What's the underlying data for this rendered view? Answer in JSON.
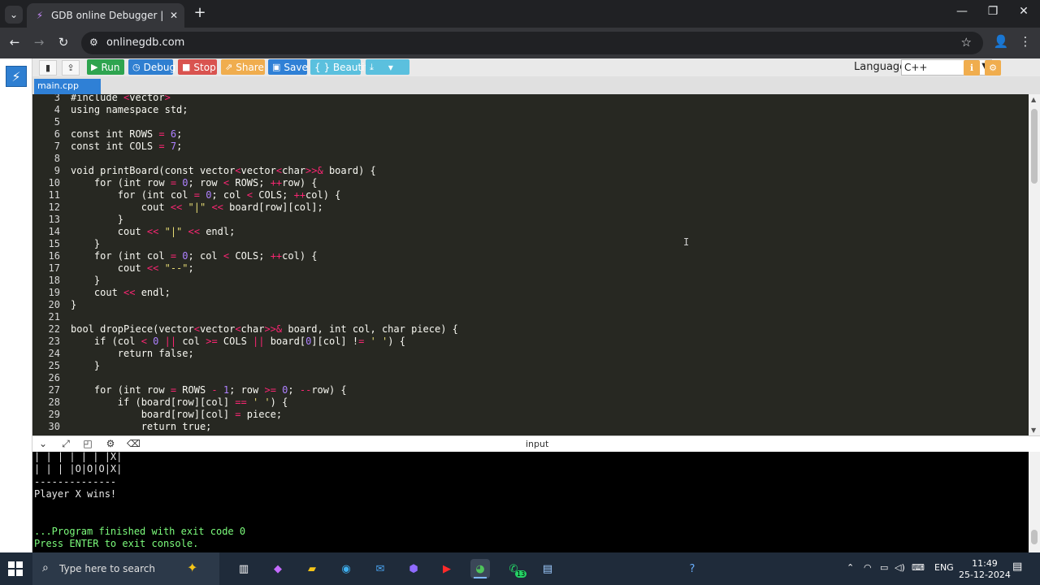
{
  "browser": {
    "tab_title": "GDB online Debugger | Compile",
    "url": "onlinegdb.com"
  },
  "toolbar": {
    "run_label": "Run",
    "debug_label": "Debug",
    "stop_label": "Stop",
    "share_label": "Share",
    "save_label": "Save",
    "beautify_label": "{ } Beautify",
    "language_label": "Language",
    "language_value": "C++"
  },
  "file_tab": "main.cpp",
  "editor": {
    "lines": [
      {
        "n": "3",
        "html": "#include <vector>"
      },
      {
        "n": "4",
        "html": "using namespace std;"
      },
      {
        "n": "5",
        "html": ""
      },
      {
        "n": "6",
        "html": "const int ROWS = 6;"
      },
      {
        "n": "7",
        "html": "const int COLS = 7;"
      },
      {
        "n": "8",
        "html": ""
      },
      {
        "n": "9",
        "html": "void printBoard(const vector<vector<char>>& board) {"
      },
      {
        "n": "10",
        "html": "    for (int row = 0; row < ROWS; ++row) {"
      },
      {
        "n": "11",
        "html": "        for (int col = 0; col < COLS; ++col) {"
      },
      {
        "n": "12",
        "html": "            cout << \"|\" << board[row][col];"
      },
      {
        "n": "13",
        "html": "        }"
      },
      {
        "n": "14",
        "html": "        cout << \"|\" << endl;"
      },
      {
        "n": "15",
        "html": "    }"
      },
      {
        "n": "16",
        "html": "    for (int col = 0; col < COLS; ++col) {"
      },
      {
        "n": "17",
        "html": "        cout << \"--\";"
      },
      {
        "n": "18",
        "html": "    }"
      },
      {
        "n": "19",
        "html": "    cout << endl;"
      },
      {
        "n": "20",
        "html": "}"
      },
      {
        "n": "21",
        "html": ""
      },
      {
        "n": "22",
        "html": "bool dropPiece(vector<vector<char>>& board, int col, char piece) {"
      },
      {
        "n": "23",
        "html": "    if (col < 0 || col >= COLS || board[0][col] != ' ') {"
      },
      {
        "n": "24",
        "html": "        return false;"
      },
      {
        "n": "25",
        "html": "    }"
      },
      {
        "n": "26",
        "html": ""
      },
      {
        "n": "27",
        "html": "    for (int row = ROWS - 1; row >= 0; --row) {"
      },
      {
        "n": "28",
        "html": "        if (board[row][col] == ' ') {"
      },
      {
        "n": "29",
        "html": "            board[row][col] = piece;"
      },
      {
        "n": "30",
        "html": "            return true;"
      }
    ]
  },
  "output": {
    "title": "input",
    "lines": [
      {
        "text": "| | | | | | |X|",
        "style": "normal"
      },
      {
        "text": "| | | |O|O|O|X|",
        "style": "normal"
      },
      {
        "text": "--------------",
        "style": "normal"
      },
      {
        "text": "Player X wins!",
        "style": "normal"
      },
      {
        "text": "",
        "style": "normal"
      },
      {
        "text": "",
        "style": "normal"
      },
      {
        "text": "...Program finished with exit code 0",
        "style": "green"
      },
      {
        "text": "Press ENTER to exit console.",
        "style": "green"
      }
    ]
  },
  "taskbar": {
    "search_placeholder": "Type here to search",
    "whatsapp_badge": "13",
    "lang": "ENG",
    "time": "11:49",
    "date": "25-12-2024"
  },
  "colors": {
    "run": "#2ea44f",
    "debug": "#2f7fd1",
    "stop": "#d9534f",
    "share": "#f0ad4e",
    "save": "#2f80d6",
    "beautify": "#5bc0de",
    "download": "#5bc0de",
    "editor_bg": "#272822"
  }
}
